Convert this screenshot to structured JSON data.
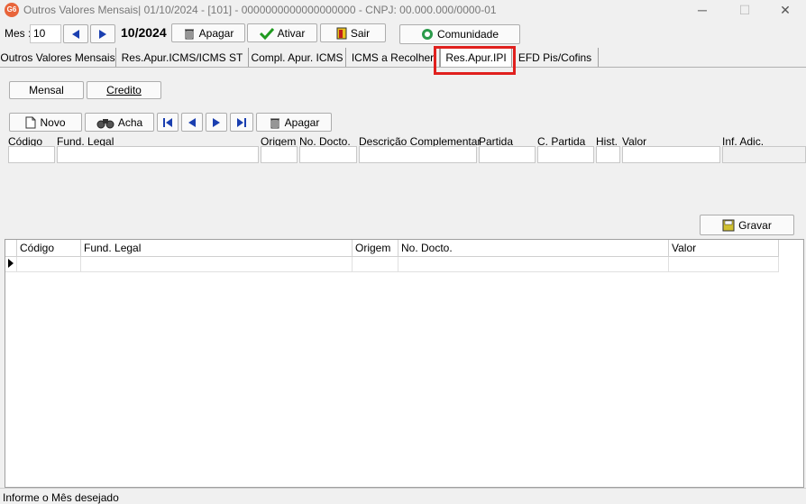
{
  "window": {
    "title": "Outros Valores Mensais|  01/10/2024 - [101] - 0000000000000000000 - CNPJ: 00.000.000/0000-01",
    "icon_text": "G6",
    "minimize": "─",
    "maximize": "☐",
    "close": "✕"
  },
  "toolbar": {
    "mes_label": "Mes :",
    "mes_value": "10",
    "period": "10/2024",
    "apagar": "Apagar",
    "ativar": "Ativar",
    "sair": "Sair",
    "comunidade": "Comunidade"
  },
  "tabs": [
    {
      "label": "Outros Valores Mensais"
    },
    {
      "label": "Res.Apur.ICMS/ICMS ST"
    },
    {
      "label": "Compl. Apur. ICMS"
    },
    {
      "label": "ICMS a Recolher"
    },
    {
      "label": "Res.Apur.IPI"
    },
    {
      "label": "EFD Pis/Cofins"
    }
  ],
  "subtabs": {
    "mensal": "Mensal",
    "credito": "Credito"
  },
  "actions": {
    "novo": "Novo",
    "acha": "Acha",
    "apagar": "Apagar",
    "gravar": "Gravar"
  },
  "form_labels": {
    "codigo": "Código",
    "fund_legal": "Fund. Legal",
    "origem": "Origem",
    "no_docto": "No. Docto.",
    "descricao": "Descrição Complementar",
    "partida": "Partida",
    "c_partida": "C. Partida",
    "hist": "Hist.",
    "valor": "Valor",
    "inf_adic": "Inf. Adic."
  },
  "grid": {
    "columns": [
      "Código",
      "Fund. Legal",
      "Origem",
      "No. Docto.",
      "Valor"
    ]
  },
  "status": "Informe o Mês desejado",
  "colors": {
    "highlight": "#e0201e",
    "nav_arrow": "#1a3fb0"
  }
}
